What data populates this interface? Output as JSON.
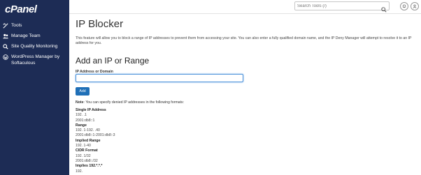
{
  "sidebar": {
    "logo": "cPanel",
    "items": [
      {
        "label": "Tools",
        "icon": "tools-icon"
      },
      {
        "label": "Manage Team",
        "icon": "team-icon"
      },
      {
        "label": "Site Quality Monitoring",
        "icon": "monitor-icon"
      },
      {
        "label": "WordPress Manager by Softaculous",
        "icon": "wordpress-icon"
      }
    ]
  },
  "topbar": {
    "search_placeholder": "Search Tools (/)",
    "icons": [
      "search-icon",
      "bell-icon",
      "user-icon"
    ]
  },
  "page": {
    "title": "IP Blocker",
    "description": "This feature will allow you to block a range of IP addresses to prevent them from accessing your site. You can also enter a fully qualified domain name, and the IP Deny Manager will attempt to resolve it to an IP address for you.",
    "section_title": "Add an IP or Range",
    "field_label": "IP Address or Domain",
    "field_value": "",
    "add_button": "Add",
    "note_label": "Note",
    "note_text": ": You can specify denied IP addresses in the following formats:",
    "formats": [
      {
        "heading": "Single IP Address",
        "examples": [
          "192.      .1",
          "2001:db8::1"
        ]
      },
      {
        "heading": "Range",
        "examples": [
          "192.        1-192.          .40",
          "2001:db8::1-2001:db8::3"
        ]
      },
      {
        "heading": "Implied Range",
        "examples": [
          "192.        1-40"
        ]
      },
      {
        "heading": "CIDR Format",
        "examples": [
          "192.        1/32",
          "2001:db8::/32"
        ]
      },
      {
        "heading": "Implies 192.*.*.*",
        "examples": [
          "192."
        ]
      }
    ]
  },
  "colors": {
    "sidebar_bg": "#1d2c55",
    "button_bg": "#1f6fb7",
    "input_focus": "#4a90d9"
  }
}
